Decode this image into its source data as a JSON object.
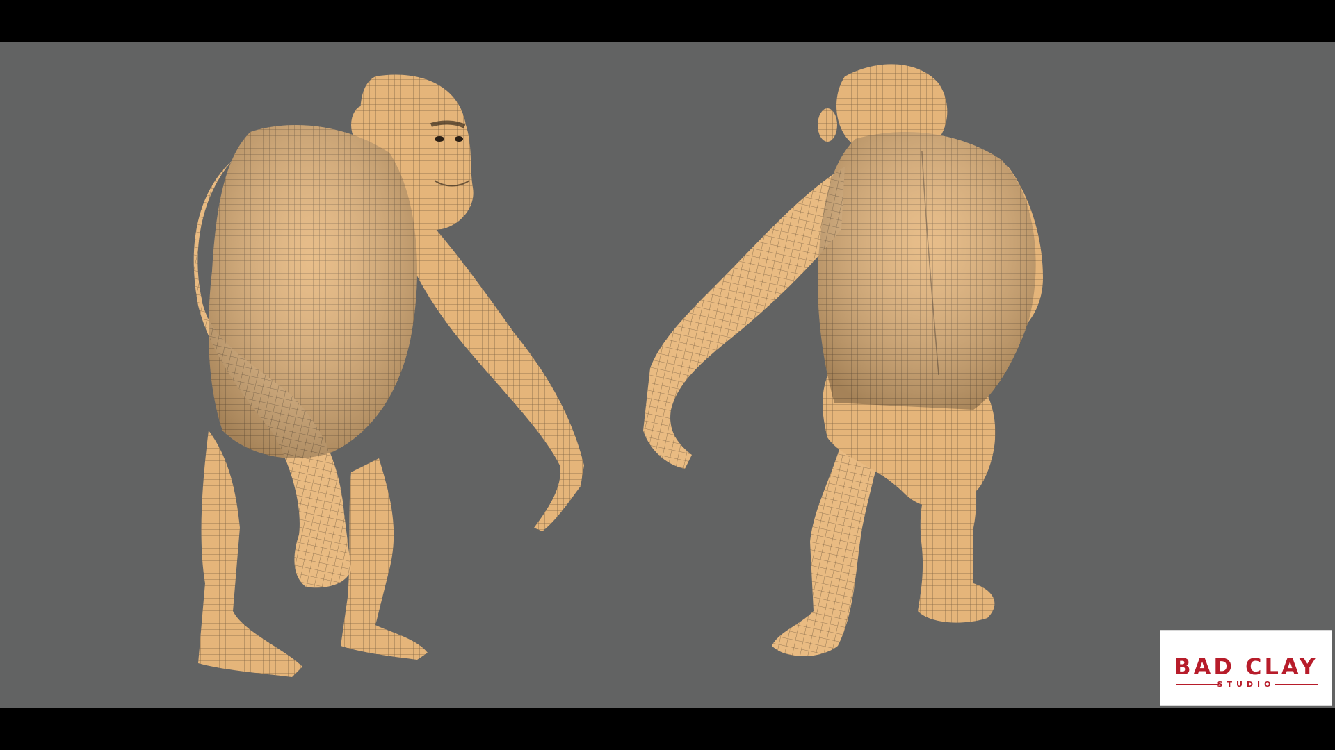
{
  "scene": {
    "background_color": "#626363",
    "letterbox_color": "#000000",
    "model_color": "#e8b878",
    "wire_color": "#5a4630",
    "subjects": [
      "chimpanzee-front-view",
      "chimpanzee-back-view"
    ]
  },
  "logo": {
    "line1": "BAD CLAY",
    "line2": "STUDIO",
    "color": "#b71c2a"
  }
}
